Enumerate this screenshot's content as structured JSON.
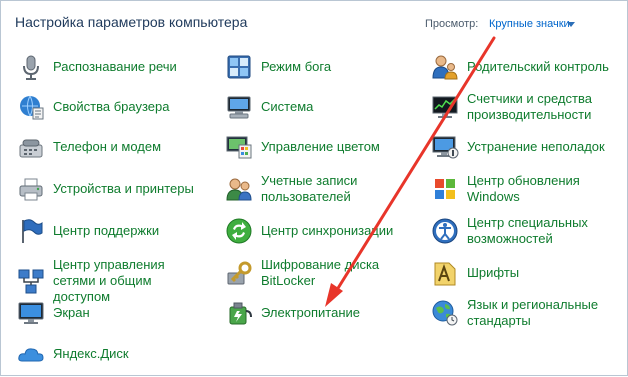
{
  "header": {
    "title": "Настройка параметров компьютера",
    "view_label": "Просмотр:",
    "view_value": "Крупные значки"
  },
  "items": [
    {
      "label": "Распознавание речи",
      "icon": "microphone-icon"
    },
    {
      "label": "Режим бога",
      "icon": "god-mode-icon"
    },
    {
      "label": "Родительский контроль",
      "icon": "parental-control-icon"
    },
    {
      "label": "Свойства браузера",
      "icon": "browser-properties-icon"
    },
    {
      "label": "Система",
      "icon": "computer-icon"
    },
    {
      "label": "Счетчики и средства производительности",
      "icon": "performance-icon"
    },
    {
      "label": "Телефон и модем",
      "icon": "phone-modem-icon"
    },
    {
      "label": "Управление цветом",
      "icon": "color-management-icon"
    },
    {
      "label": "Устранение неполадок",
      "icon": "troubleshooting-icon"
    },
    {
      "label": "Устройства и принтеры",
      "icon": "printer-icon"
    },
    {
      "label": "Учетные записи пользователей",
      "icon": "user-accounts-icon"
    },
    {
      "label": "Центр обновления Windows",
      "icon": "windows-update-icon"
    },
    {
      "label": "Центр поддержки",
      "icon": "flag-icon"
    },
    {
      "label": "Центр синхронизации",
      "icon": "sync-icon"
    },
    {
      "label": "Центр специальных возможностей",
      "icon": "accessibility-icon"
    },
    {
      "label": "Центр управления сетями и общим доступом",
      "icon": "network-icon"
    },
    {
      "label": "Шифрование диска BitLocker",
      "icon": "bitlocker-key-icon"
    },
    {
      "label": "Шрифты",
      "icon": "fonts-icon"
    },
    {
      "label": "Экран",
      "icon": "display-icon"
    },
    {
      "label": "Электропитание",
      "icon": "power-options-icon"
    },
    {
      "label": "Язык и региональные стандарты",
      "icon": "region-language-icon"
    },
    {
      "label": "Яндекс.Диск",
      "icon": "cloud-icon"
    }
  ],
  "colors": {
    "link": "#0f7c2e",
    "title": "#1e395b",
    "annotation_arrow": "#e8352a"
  }
}
